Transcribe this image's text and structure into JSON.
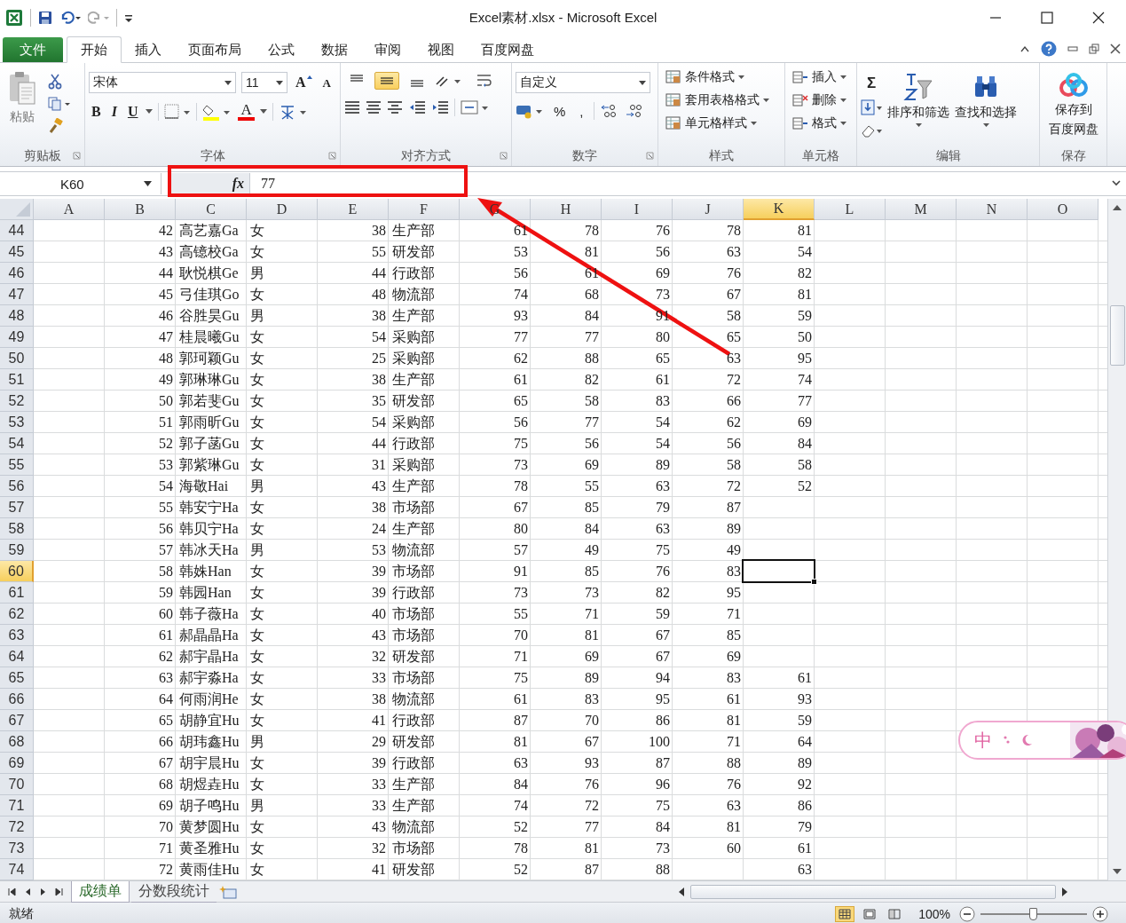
{
  "window": {
    "title": "Excel素材.xlsx - Microsoft Excel"
  },
  "file_tab": "文件",
  "ribbon_tabs": [
    {
      "label": "开始",
      "selected": true
    },
    {
      "label": "插入",
      "selected": false
    },
    {
      "label": "页面布局",
      "selected": false
    },
    {
      "label": "公式",
      "selected": false
    },
    {
      "label": "数据",
      "selected": false
    },
    {
      "label": "审阅",
      "selected": false
    },
    {
      "label": "视图",
      "selected": false
    },
    {
      "label": "百度网盘",
      "selected": false
    }
  ],
  "ribbon": {
    "clipboard": {
      "paste": "粘贴",
      "label": "剪贴板"
    },
    "font": {
      "name": "宋体",
      "size": "11",
      "grow": "A",
      "shrink": "A",
      "bold": "B",
      "italic": "I",
      "underline": "U",
      "color_letter": "A",
      "label": "字体"
    },
    "alignment": {
      "vertical": [
        {
          "selected": false
        },
        {
          "selected": true
        },
        {
          "selected": false
        }
      ],
      "label": "对齐方式"
    },
    "number": {
      "format": "自定义",
      "percent": "%",
      "comma": ",",
      "label": "数字"
    },
    "styles": {
      "items": [
        "条件格式",
        "套用表格格式",
        "单元格样式"
      ],
      "label": "样式"
    },
    "cells": {
      "items": [
        "插入",
        "删除",
        "格式"
      ],
      "label": "单元格"
    },
    "editing": {
      "sum": "Σ",
      "items": [
        "排序和筛选",
        "查找和选择"
      ],
      "label": "编辑"
    },
    "save": {
      "button": [
        "保存到",
        "百度网盘"
      ],
      "label": "保存"
    }
  },
  "formula_bar": {
    "name_box": "K60",
    "fx": "fx",
    "value": "77"
  },
  "columns": [
    {
      "label": "A",
      "selected": false
    },
    {
      "label": "B",
      "selected": false
    },
    {
      "label": "C",
      "selected": false
    },
    {
      "label": "D",
      "selected": false
    },
    {
      "label": "E",
      "selected": false
    },
    {
      "label": "F",
      "selected": false
    },
    {
      "label": "G",
      "selected": false
    },
    {
      "label": "H",
      "selected": false
    },
    {
      "label": "I",
      "selected": false
    },
    {
      "label": "J",
      "selected": false
    },
    {
      "label": "K",
      "selected": true
    },
    {
      "label": "L",
      "selected": false
    },
    {
      "label": "M",
      "selected": false
    },
    {
      "label": "N",
      "selected": false
    },
    {
      "label": "O",
      "selected": false
    }
  ],
  "rows": [
    {
      "number": "44",
      "selected": false,
      "cells": [
        "42",
        "高艺嘉Ga",
        "女",
        "38",
        "生产部",
        "61",
        "78",
        "76",
        "78",
        "81"
      ]
    },
    {
      "number": "45",
      "selected": false,
      "cells": [
        "43",
        "高镱校Ga",
        "女",
        "55",
        "研发部",
        "53",
        "81",
        "56",
        "63",
        "54"
      ]
    },
    {
      "number": "46",
      "selected": false,
      "cells": [
        "44",
        "耿悦棋Ge",
        "男",
        "44",
        "行政部",
        "56",
        "61",
        "69",
        "76",
        "82"
      ]
    },
    {
      "number": "47",
      "selected": false,
      "cells": [
        "45",
        "弓佳琪Go",
        "女",
        "48",
        "物流部",
        "74",
        "68",
        "73",
        "67",
        "81"
      ]
    },
    {
      "number": "48",
      "selected": false,
      "cells": [
        "46",
        "谷胜昊Gu",
        "男",
        "38",
        "生产部",
        "93",
        "84",
        "91",
        "58",
        "59"
      ]
    },
    {
      "number": "49",
      "selected": false,
      "cells": [
        "47",
        "桂晨曦Gu",
        "女",
        "54",
        "采购部",
        "77",
        "77",
        "80",
        "65",
        "50"
      ]
    },
    {
      "number": "50",
      "selected": false,
      "cells": [
        "48",
        "郭珂颖Gu",
        "女",
        "25",
        "采购部",
        "62",
        "88",
        "65",
        "63",
        "95"
      ]
    },
    {
      "number": "51",
      "selected": false,
      "cells": [
        "49",
        "郭琳琳Gu",
        "女",
        "38",
        "生产部",
        "61",
        "82",
        "61",
        "72",
        "74"
      ]
    },
    {
      "number": "52",
      "selected": false,
      "cells": [
        "50",
        "郭若斐Gu",
        "女",
        "35",
        "研发部",
        "65",
        "58",
        "83",
        "66",
        "77"
      ]
    },
    {
      "number": "53",
      "selected": false,
      "cells": [
        "51",
        "郭雨昕Gu",
        "女",
        "54",
        "采购部",
        "56",
        "77",
        "54",
        "62",
        "69"
      ]
    },
    {
      "number": "54",
      "selected": false,
      "cells": [
        "52",
        "郭子菡Gu",
        "女",
        "44",
        "行政部",
        "75",
        "56",
        "54",
        "56",
        "84"
      ]
    },
    {
      "number": "55",
      "selected": false,
      "cells": [
        "53",
        "郭紫琳Gu",
        "女",
        "31",
        "采购部",
        "73",
        "69",
        "89",
        "58",
        "58"
      ]
    },
    {
      "number": "56",
      "selected": false,
      "cells": [
        "54",
        "海敬Hai",
        "男",
        "43",
        "生产部",
        "78",
        "55",
        "63",
        "72",
        "52"
      ]
    },
    {
      "number": "57",
      "selected": false,
      "cells": [
        "55",
        "韩安宁Ha",
        "女",
        "38",
        "市场部",
        "67",
        "85",
        "79",
        "87",
        null
      ]
    },
    {
      "number": "58",
      "selected": false,
      "cells": [
        "56",
        "韩贝宁Ha",
        "女",
        "24",
        "生产部",
        "80",
        "84",
        "63",
        "89",
        null
      ]
    },
    {
      "number": "59",
      "selected": false,
      "cells": [
        "57",
        "韩冰天Ha",
        "男",
        "53",
        "物流部",
        "57",
        "49",
        "75",
        "49",
        null
      ]
    },
    {
      "number": "60",
      "selected": true,
      "cells": [
        "58",
        "韩姝Han",
        "女",
        "39",
        "市场部",
        "91",
        "85",
        "76",
        "83",
        null
      ]
    },
    {
      "number": "61",
      "selected": false,
      "cells": [
        "59",
        "韩园Han",
        "女",
        "39",
        "行政部",
        "73",
        "73",
        "82",
        "95",
        null
      ]
    },
    {
      "number": "62",
      "selected": false,
      "cells": [
        "60",
        "韩子薇Ha",
        "女",
        "40",
        "市场部",
        "55",
        "71",
        "59",
        "71",
        null
      ]
    },
    {
      "number": "63",
      "selected": false,
      "cells": [
        "61",
        "郝晶晶Ha",
        "女",
        "43",
        "市场部",
        "70",
        "81",
        "67",
        "85",
        null
      ]
    },
    {
      "number": "64",
      "selected": false,
      "cells": [
        "62",
        "郝宇晶Ha",
        "女",
        "32",
        "研发部",
        "71",
        "69",
        "67",
        "69",
        null
      ]
    },
    {
      "number": "65",
      "selected": false,
      "cells": [
        "63",
        "郝宇淼Ha",
        "女",
        "33",
        "市场部",
        "75",
        "89",
        "94",
        "83",
        "61"
      ]
    },
    {
      "number": "66",
      "selected": false,
      "cells": [
        "64",
        "何雨润He",
        "女",
        "38",
        "物流部",
        "61",
        "83",
        "95",
        "61",
        "93"
      ]
    },
    {
      "number": "67",
      "selected": false,
      "cells": [
        "65",
        "胡静宜Hu",
        "女",
        "41",
        "行政部",
        "87",
        "70",
        "86",
        "81",
        "59"
      ]
    },
    {
      "number": "68",
      "selected": false,
      "cells": [
        "66",
        "胡玮鑫Hu",
        "男",
        "29",
        "研发部",
        "81",
        "67",
        "100",
        "71",
        "64"
      ]
    },
    {
      "number": "69",
      "selected": false,
      "cells": [
        "67",
        "胡宇晨Hu",
        "女",
        "39",
        "行政部",
        "63",
        "93",
        "87",
        "88",
        "89"
      ]
    },
    {
      "number": "70",
      "selected": false,
      "cells": [
        "68",
        "胡煜垚Hu",
        "女",
        "33",
        "生产部",
        "84",
        "76",
        "96",
        "76",
        "92"
      ]
    },
    {
      "number": "71",
      "selected": false,
      "cells": [
        "69",
        "胡子鸣Hu",
        "男",
        "33",
        "生产部",
        "74",
        "72",
        "75",
        "63",
        "86"
      ]
    },
    {
      "number": "72",
      "selected": false,
      "cells": [
        "70",
        "黄梦圆Hu",
        "女",
        "43",
        "物流部",
        "52",
        "77",
        "84",
        "81",
        "79"
      ]
    },
    {
      "number": "73",
      "selected": false,
      "cells": [
        "71",
        "黄圣雅Hu",
        "女",
        "32",
        "市场部",
        "78",
        "81",
        "73",
        "60",
        "61"
      ]
    },
    {
      "number": "74",
      "selected": false,
      "cells": [
        "72",
        "黄雨佳Hu",
        "女",
        "41",
        "研发部",
        "52",
        "87",
        "88",
        null,
        "63"
      ]
    }
  ],
  "sheet_tabs": [
    {
      "label": "成绩单",
      "selected": true
    },
    {
      "label": "分数段统计",
      "selected": false
    }
  ],
  "status_bar": {
    "mode": "就绪",
    "views": [
      {
        "selected": true
      },
      {
        "selected": false
      },
      {
        "selected": false
      }
    ],
    "zoom": "100%",
    "zoom_slider": {
      "level": 0.5
    }
  },
  "ime_bar": {
    "label": "中"
  }
}
